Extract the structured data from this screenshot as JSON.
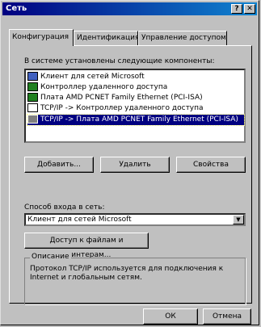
{
  "window": {
    "title": "Сеть",
    "help_label": "?",
    "close_label": "✕"
  },
  "tabs": [
    {
      "label": "Конфигурация"
    },
    {
      "label": "Идентификация"
    },
    {
      "label": "Управление доступом"
    }
  ],
  "components_label": "В системе установлены следующие компоненты:",
  "components": [
    {
      "label": "Клиент для сетей Microsoft",
      "icon": "client-icon"
    },
    {
      "label": "Контроллер удаленного доступа",
      "icon": "adapter-icon"
    },
    {
      "label": "Плата AMD PCNET Family Ethernet (PCI-ISA)",
      "icon": "adapter-icon"
    },
    {
      "label": "TCP/IP -> Контроллер удаленного доступа",
      "icon": "protocol-icon"
    },
    {
      "label": "TCP/IP -> Плата AMD PCNET Family Ethernet (PCI-ISA)",
      "icon": "protocol-icon",
      "selected": true
    }
  ],
  "buttons": {
    "add": "Добавить...",
    "remove": "Удалить",
    "properties": "Свойства",
    "sharing": "Доступ к файлам и принтерам...",
    "ok": "ОК",
    "cancel": "Отмена"
  },
  "logon": {
    "label": "Способ входа в сеть:",
    "value": "Клиент для сетей Microsoft"
  },
  "description": {
    "title": "Описание",
    "text": "Протокол TCP/IP используется для подключения к Internet и глобальным сетям."
  },
  "colors": {
    "titlebar": "#000080",
    "selection": "#000080",
    "face": "#c0c0c0"
  }
}
